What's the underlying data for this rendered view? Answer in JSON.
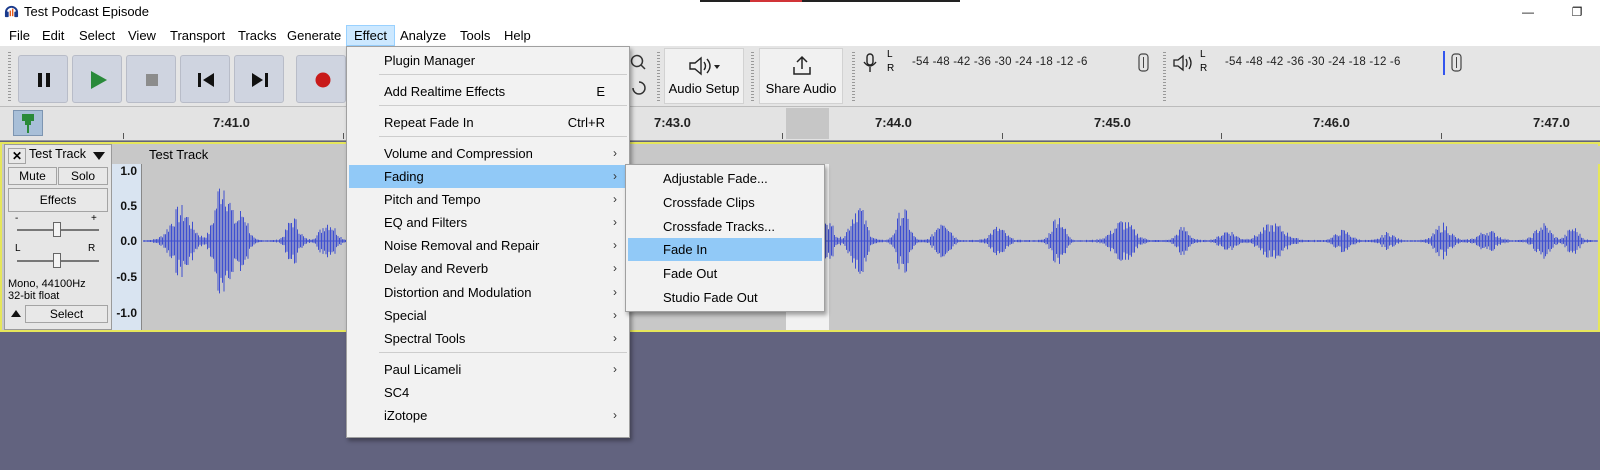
{
  "window": {
    "title": "Test Podcast Episode",
    "minimize": "—",
    "restore": "❐"
  },
  "menubar": [
    "File",
    "Edit",
    "Select",
    "View",
    "Transport",
    "Tracks",
    "Generate",
    "Effect",
    "Analyze",
    "Tools",
    "Help"
  ],
  "toolbar": {
    "audio_setup": "Audio Setup",
    "share_audio": "Share Audio",
    "meter_scale": "-54 -48 -42 -36 -30 -24 -18 -12 -6",
    "meter_l": "L",
    "meter_r": "R"
  },
  "timeline": {
    "times": [
      "7:41.0",
      "7:43.0",
      "7:44.0",
      "7:45.0",
      "7:46.0",
      "7:47.0"
    ]
  },
  "track": {
    "name": "Test Track",
    "mute": "Mute",
    "solo": "Solo",
    "effects": "Effects",
    "gain_minus": "-",
    "gain_plus": "+",
    "pan_left": "L",
    "pan_right": "R",
    "format_line1": "Mono, 44100Hz",
    "format_line2": "32-bit float",
    "select": "Select",
    "clip_name": "Test Track",
    "scale": [
      "1.0",
      "0.5",
      "0.0",
      "-0.5",
      "-1.0"
    ]
  },
  "effect_menu": {
    "items": [
      {
        "label": "Plugin Manager",
        "shortcut": "",
        "arrow": ""
      },
      {
        "label": "Add Realtime Effects",
        "shortcut": "E",
        "arrow": ""
      },
      {
        "label": "Repeat Fade In",
        "shortcut": "Ctrl+R",
        "arrow": ""
      },
      {
        "label": "Volume and Compression",
        "shortcut": "",
        "arrow": "›"
      },
      {
        "label": "Fading",
        "shortcut": "",
        "arrow": "›"
      },
      {
        "label": "Pitch and Tempo",
        "shortcut": "",
        "arrow": "›"
      },
      {
        "label": "EQ and Filters",
        "shortcut": "",
        "arrow": "›"
      },
      {
        "label": "Noise Removal and Repair",
        "shortcut": "",
        "arrow": "›"
      },
      {
        "label": "Delay and Reverb",
        "shortcut": "",
        "arrow": "›"
      },
      {
        "label": "Distortion and Modulation",
        "shortcut": "",
        "arrow": "›"
      },
      {
        "label": "Special",
        "shortcut": "",
        "arrow": "›"
      },
      {
        "label": "Spectral Tools",
        "shortcut": "",
        "arrow": "›"
      },
      {
        "label": "Paul Licameli",
        "shortcut": "",
        "arrow": "›"
      },
      {
        "label": "SC4",
        "shortcut": "",
        "arrow": ""
      },
      {
        "label": "iZotope",
        "shortcut": "",
        "arrow": "›"
      }
    ]
  },
  "fading_menu": {
    "items": [
      {
        "label": "Adjustable Fade..."
      },
      {
        "label": "Crossfade Clips"
      },
      {
        "label": "Crossfade Tracks..."
      },
      {
        "label": "Fade In"
      },
      {
        "label": "Fade Out"
      },
      {
        "label": "Studio Fade Out"
      }
    ]
  }
}
